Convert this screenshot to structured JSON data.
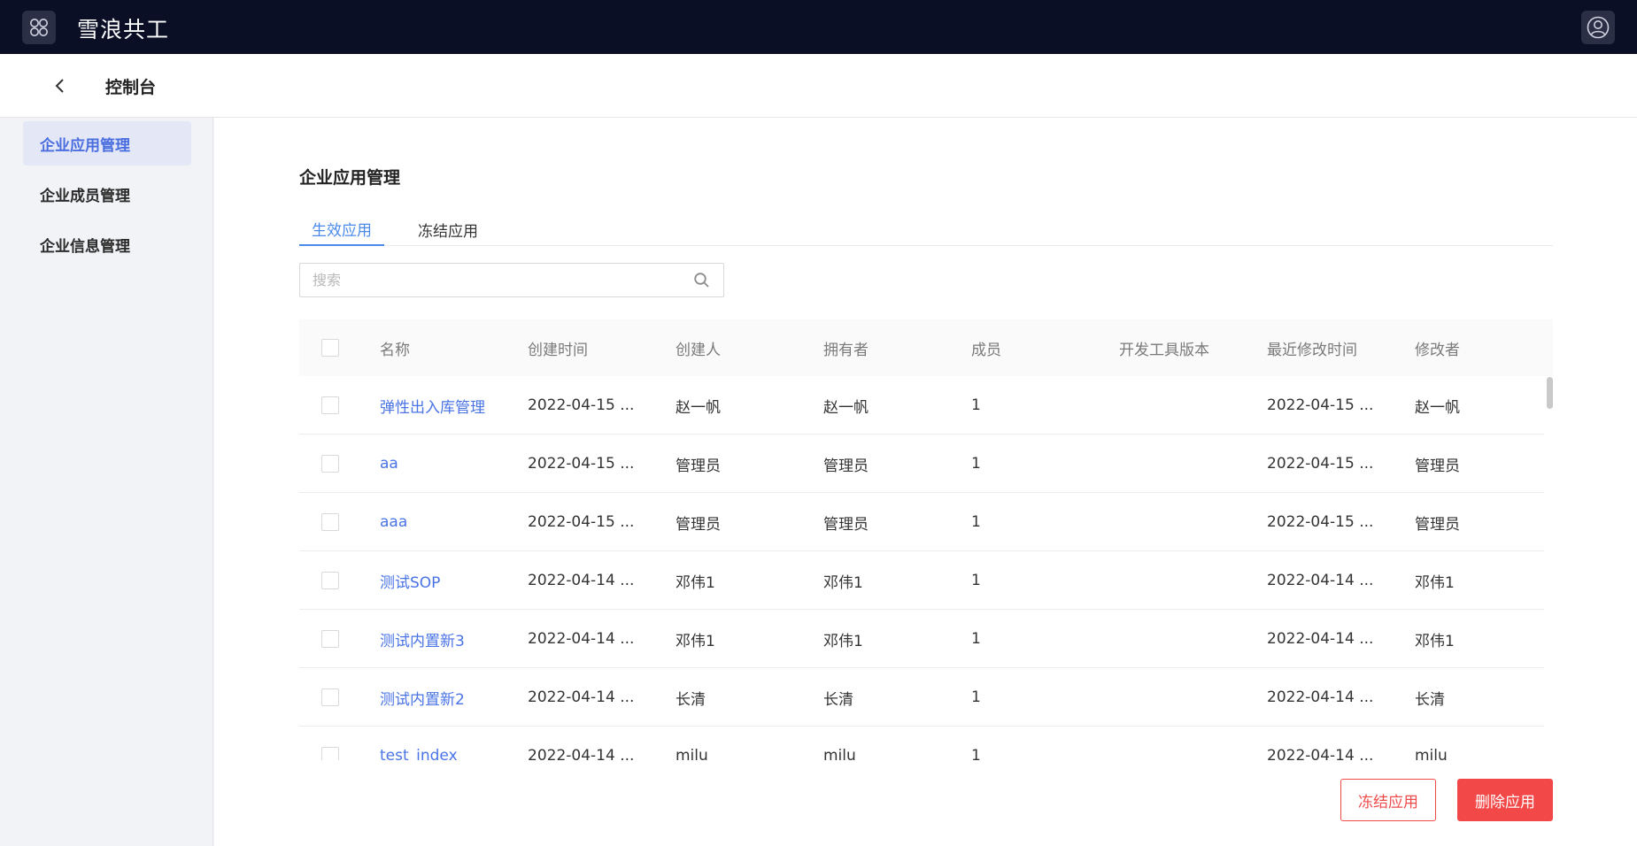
{
  "header": {
    "brand": "雪浪共工"
  },
  "subheader": {
    "title": "控制台"
  },
  "sidebar": {
    "items": [
      {
        "label": "企业应用管理",
        "active": true
      },
      {
        "label": "企业成员管理",
        "active": false
      },
      {
        "label": "企业信息管理",
        "active": false
      }
    ]
  },
  "main": {
    "title": "企业应用管理",
    "tabs": [
      {
        "label": "生效应用",
        "active": true
      },
      {
        "label": "冻结应用",
        "active": false
      }
    ],
    "search": {
      "placeholder": "搜索",
      "value": ""
    },
    "table": {
      "columns": [
        "名称",
        "创建时间",
        "创建人",
        "拥有者",
        "成员",
        "开发工具版本",
        "最近修改时间",
        "修改者"
      ],
      "rows": [
        {
          "name": "弹性出入库管理",
          "created": "2022-04-15 ...",
          "creator": "赵一帆",
          "owner": "赵一帆",
          "members": "1",
          "version": "",
          "modified": "2022-04-15 ...",
          "modifier": "赵一帆"
        },
        {
          "name": "aa",
          "created": "2022-04-15 ...",
          "creator": "管理员",
          "owner": "管理员",
          "members": "1",
          "version": "",
          "modified": "2022-04-15 ...",
          "modifier": "管理员"
        },
        {
          "name": "aaa",
          "created": "2022-04-15 ...",
          "creator": "管理员",
          "owner": "管理员",
          "members": "1",
          "version": "",
          "modified": "2022-04-15 ...",
          "modifier": "管理员"
        },
        {
          "name": "测试SOP",
          "created": "2022-04-14 ...",
          "creator": "邓伟1",
          "owner": "邓伟1",
          "members": "1",
          "version": "",
          "modified": "2022-04-14 ...",
          "modifier": "邓伟1"
        },
        {
          "name": "测试内置新3",
          "created": "2022-04-14 ...",
          "creator": "邓伟1",
          "owner": "邓伟1",
          "members": "1",
          "version": "",
          "modified": "2022-04-14 ...",
          "modifier": "邓伟1"
        },
        {
          "name": "测试内置新2",
          "created": "2022-04-14 ...",
          "creator": "长清",
          "owner": "长清",
          "members": "1",
          "version": "",
          "modified": "2022-04-14 ...",
          "modifier": "长清"
        },
        {
          "name": "test_index",
          "created": "2022-04-14 ...",
          "creator": "milu",
          "owner": "milu",
          "members": "1",
          "version": "",
          "modified": "2022-04-14 ...",
          "modifier": "milu"
        }
      ]
    },
    "actions": {
      "freeze_label": "冻结应用",
      "delete_label": "删除应用"
    }
  },
  "icons": {
    "apps": "apps-grid-icon",
    "user": "user-avatar-icon",
    "back": "chevron-left-icon",
    "search": "search-icon"
  },
  "colors": {
    "topbar": "#0b0f26",
    "accent": "#4a74e6",
    "tab_active": "#4a8bea",
    "danger": "#f24848"
  }
}
